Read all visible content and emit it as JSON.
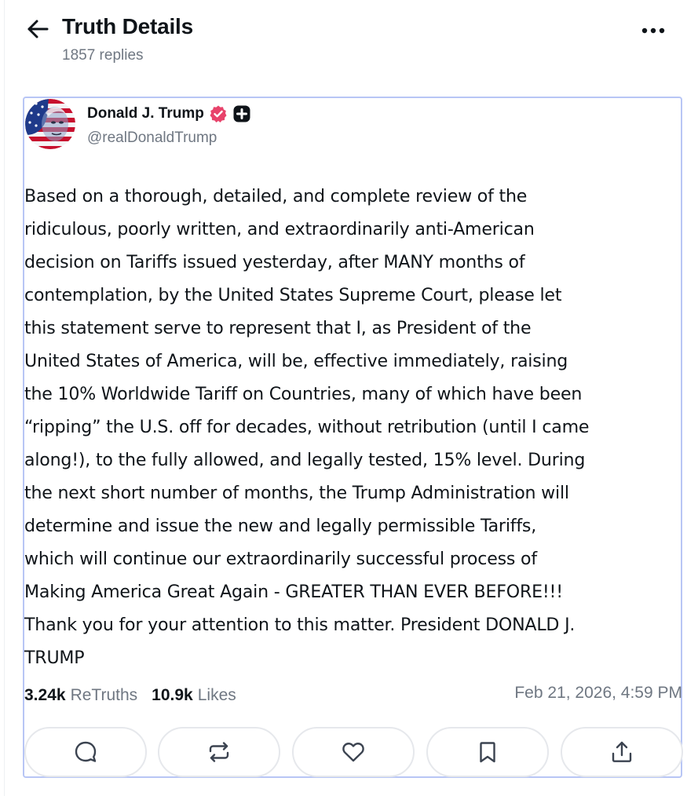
{
  "header": {
    "title": "Truth Details",
    "reply_count": "1857 replies",
    "back_icon": "arrow-left-icon",
    "more_icon": "more-horizontal-icon"
  },
  "post": {
    "author": {
      "name": "Donald J. Trump",
      "handle": "@realDonaldTrump",
      "verified_icon": "verified-badge-icon",
      "verified_color": "#e8436b",
      "plus_icon": "plus-badge-icon"
    },
    "body": "Based on a thorough, detailed, and complete review of the\nridiculous, poorly written, and extraordinarily anti-American\ndecision on Tariffs issued yesterday, after MANY months of\ncontemplation, by the United States Supreme Court, please let\nthis statement serve to represent that I, as President of the\nUnited States of America, will be, effective immediately, raising\nthe 10% Worldwide Tariff on Countries, many of which have been\n“ripping” the U.S. off for decades, without retribution (until I came\nalong!), to the fully allowed, and legally tested, 15% level. During\nthe next short number of months, the Trump Administration will\ndetermine and issue the new and legally permissible Tariffs,\nwhich will continue our extraordinarily successful process of\nMaking America Great Again - GREATER THAN EVER BEFORE!!!\nThank you for your attention to this matter. President DONALD J.\nTRUMP",
    "stats": {
      "retruths_count": "3.24k",
      "retruths_label": "ReTruths",
      "likes_count": "10.9k",
      "likes_label": "Likes"
    },
    "timestamp": "Feb 21, 2026, 4:59 PM",
    "actions": [
      {
        "name": "reply",
        "icon": "comment-icon"
      },
      {
        "name": "retruth",
        "icon": "repost-icon"
      },
      {
        "name": "like",
        "icon": "heart-icon"
      },
      {
        "name": "bookmark",
        "icon": "bookmark-icon"
      },
      {
        "name": "share",
        "icon": "share-icon"
      }
    ]
  },
  "colors": {
    "text_primary": "#0f1419",
    "text_secondary": "#6f7782",
    "card_border": "#b8c6f5",
    "button_border": "#e6e8ec"
  }
}
